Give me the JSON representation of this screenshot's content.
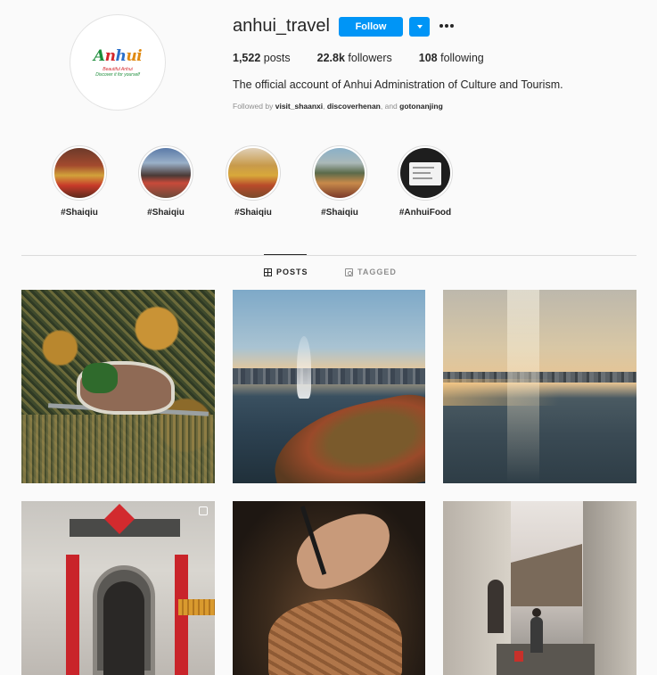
{
  "profile": {
    "username": "anhui_travel",
    "follow_label": "Follow",
    "logo_word": [
      "A",
      "n",
      "h",
      "ui"
    ],
    "logo_line1": "Beautiful Anhui",
    "logo_line2": "Discover it for yourself",
    "stats": {
      "posts_count": "1,522",
      "posts_label": "posts",
      "followers_count": "22.8k",
      "followers_label": "followers",
      "following_count": "108",
      "following_label": "following"
    },
    "bio": "The official account of Anhui Administration of Culture and Tourism.",
    "followed_by": {
      "prefix": "Followed by",
      "user1": "visit_shaanxi",
      "sep1": ",",
      "user2": "discoverhenan",
      "sep2": ", and",
      "user3": "gotonanjing"
    }
  },
  "highlights": [
    {
      "label": "#Shaiqiu"
    },
    {
      "label": "#Shaiqiu"
    },
    {
      "label": "#Shaiqiu"
    },
    {
      "label": "#Shaiqiu"
    },
    {
      "label": "#AnhuiFood"
    }
  ],
  "tabs": {
    "posts": "POSTS",
    "tagged": "TAGGED"
  },
  "colors": {
    "accent": "#0095f6",
    "text": "#262626",
    "muted": "#8e8e8e",
    "background": "#fafafa"
  }
}
